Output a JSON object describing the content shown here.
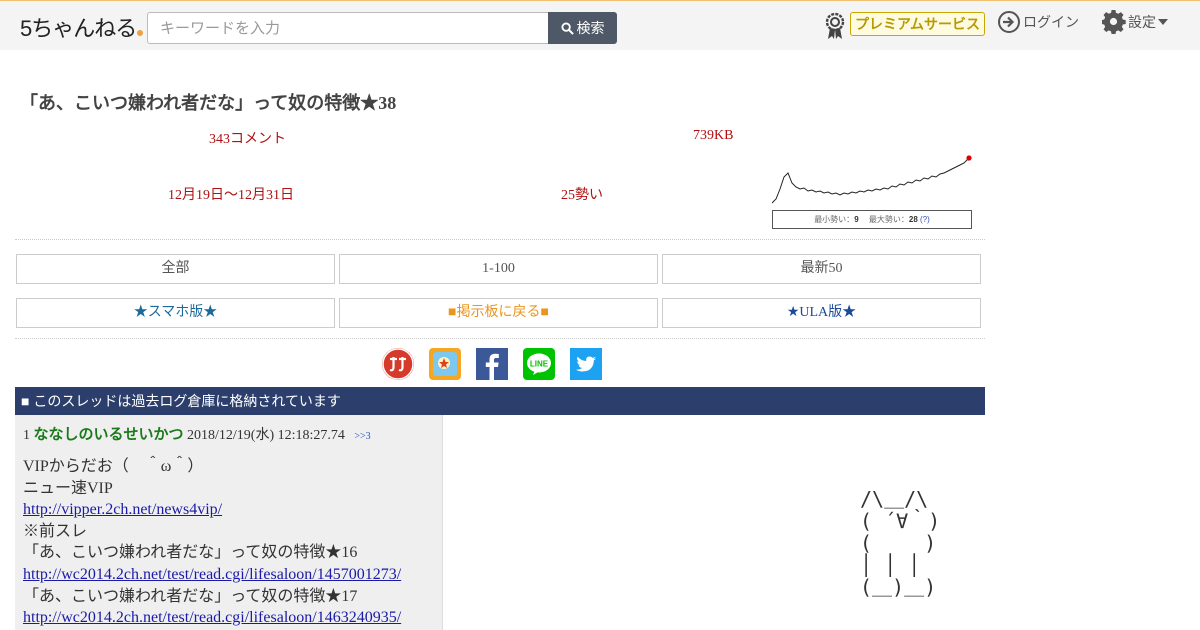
{
  "header": {
    "logo_text": "5ちゃんねる",
    "search_placeholder": "キーワードを入力",
    "search_button": "検索",
    "premium_label": "プレミアムサービス",
    "login_label": "ログイン",
    "settings_label": "設定"
  },
  "thread": {
    "title": "「あ、こいつ嫌われ者だな」って奴の特徴★38",
    "comments": "343コメント",
    "size": "739KB",
    "period": "12月19日〜12月31日",
    "momentum": "25勢い",
    "graph": {
      "min_label": "最小勢い：",
      "min_value": "9",
      "max_label": "最大勢い：",
      "max_value": "28",
      "help": "(?)"
    }
  },
  "nav": {
    "all": "全部",
    "range": "1-100",
    "latest": "最新50",
    "smartphone": "★スマホ版★",
    "back_to_board": "■掲示板に戻る■",
    "ula": "★ULA版★"
  },
  "share_icons": [
    "matome-icon",
    "bookmark-icon",
    "facebook-icon",
    "line-icon",
    "twitter-icon"
  ],
  "archive_notice": "■ このスレッドは過去ログ倉庫に格納されています",
  "post": {
    "number": "1",
    "name": "ななしのいるせいかつ",
    "date": "2018/12/19(水) 12:18:27.74",
    "reply_ref": ">>3",
    "lines": [
      {
        "text": "VIPからだお（　＾ω＾）",
        "link": false
      },
      {
        "text": "ニュー速VIP",
        "link": false
      },
      {
        "text": "http://vipper.2ch.net/news4vip/",
        "link": true
      },
      {
        "text": "※前スレ",
        "link": false
      },
      {
        "text": "「あ、こいつ嫌われ者だな」って奴の特徴★16",
        "link": false
      },
      {
        "text": "http://wc2014.2ch.net/test/read.cgi/lifesaloon/1457001273/",
        "link": true
      },
      {
        "text": "「あ、こいつ嫌われ者だな」って奴の特徴★17",
        "link": false
      },
      {
        "text": "http://wc2014.2ch.net/test/read.cgi/lifesaloon/1463240935/",
        "link": true
      }
    ]
  },
  "ascii_art": "/\\＿/\\\n( ´∀｀)\n(　　 )\n│ │ │\n(＿)＿)",
  "colors": {
    "archive_bar": "#2c3e6b",
    "stat_red": "#b01010",
    "name_green": "#1a7a1a",
    "premium_gold": "#b89a00"
  }
}
